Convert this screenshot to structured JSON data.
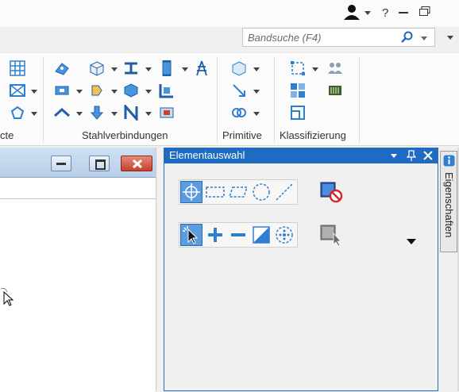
{
  "search": {
    "placeholder": "Bandsuche (F4)"
  },
  "ribbon": {
    "groups": [
      {
        "label": "cte"
      },
      {
        "label": "Stahlverbindungen"
      },
      {
        "label": "Primitive"
      },
      {
        "label": "Klassifizierung"
      }
    ]
  },
  "panel": {
    "title": "Elementauswahl"
  },
  "sidetab": {
    "label": "Eigenschaften"
  },
  "colors": {
    "accent": "#1f6bc1",
    "panel_title_bg": "#1f6bc1",
    "close_red": "#c4412b"
  },
  "icons": [
    "user-icon",
    "help-icon",
    "minimize-icon",
    "restore-icon",
    "search-icon",
    "pin-icon",
    "close-icon",
    "properties-icon"
  ]
}
